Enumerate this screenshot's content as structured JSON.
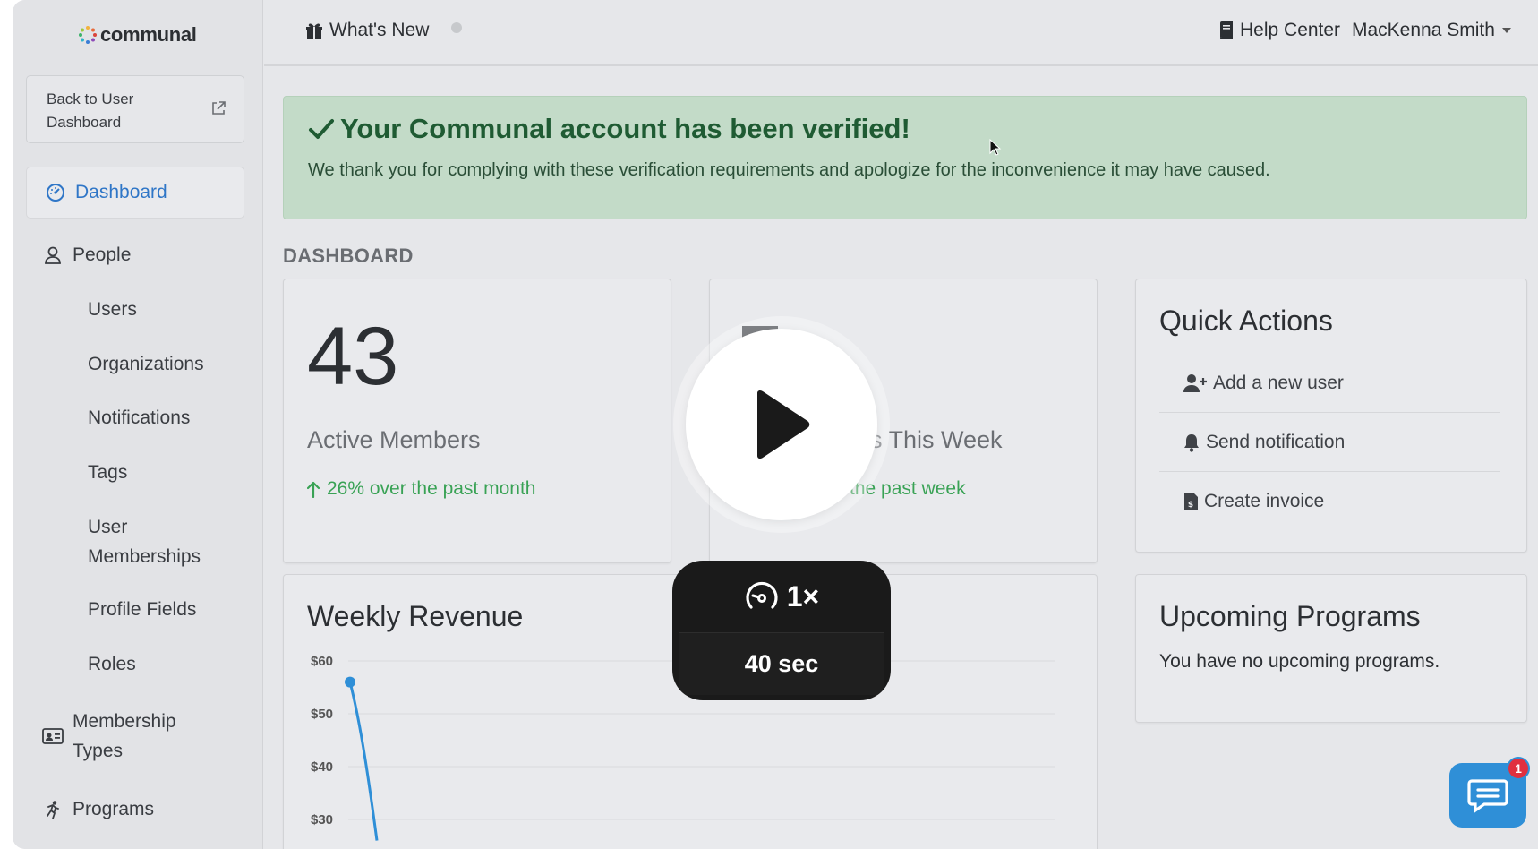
{
  "app": {
    "name": "communal"
  },
  "sidebar": {
    "back_label": "Back to User Dashboard",
    "items": [
      {
        "label": "Dashboard",
        "icon": "dashboard-gauge-icon",
        "active": true
      },
      {
        "label": "People",
        "icon": "person-icon"
      },
      {
        "label": "Users"
      },
      {
        "label": "Organizations"
      },
      {
        "label": "Notifications"
      },
      {
        "label": "Tags"
      },
      {
        "label": "User Memberships"
      },
      {
        "label": "Profile Fields"
      },
      {
        "label": "Roles"
      },
      {
        "label": "Membership Types",
        "icon": "id-card-icon"
      },
      {
        "label": "Programs",
        "icon": "running-person-icon"
      }
    ]
  },
  "topbar": {
    "whats_new": "What's New",
    "help_center": "Help Center",
    "user_name": "MacKenna Smith"
  },
  "alert": {
    "title": "Your Communal account has been verified!",
    "body": "We thank you for complying with these verification requirements and apologize for the inconvenience it may have caused."
  },
  "dashboard": {
    "section_label": "DASHBOARD",
    "active_members": {
      "value": "43",
      "label": "Active Members",
      "trend": "26% over the past month"
    },
    "new_members": {
      "label_partial": "rs This Week",
      "trend_partial": "the past week"
    },
    "quick_actions": {
      "title": "Quick Actions",
      "items": [
        "Add a new user",
        "Send notification",
        "Create invoice"
      ]
    },
    "upcoming_programs": {
      "title": "Upcoming Programs",
      "empty_text": "You have no upcoming programs."
    },
    "weekly_revenue": {
      "title": "Weekly Revenue"
    }
  },
  "chart_data": {
    "type": "line",
    "title": "Weekly Revenue",
    "y_ticks": [
      "$60",
      "$50",
      "$40",
      "$30"
    ],
    "ylim": [
      30,
      60
    ],
    "series": [
      {
        "values": [
          56,
          26
        ]
      }
    ],
    "grid": true
  },
  "player": {
    "speed": "1×",
    "duration": "40 sec"
  },
  "chat": {
    "badge_count": "1"
  },
  "colors": {
    "accent": "#2f76c7",
    "success_bg": "#c3dbc8",
    "success_text": "#1f5b33",
    "trend_green": "#39a255",
    "chat_blue": "#2f8fd7"
  }
}
